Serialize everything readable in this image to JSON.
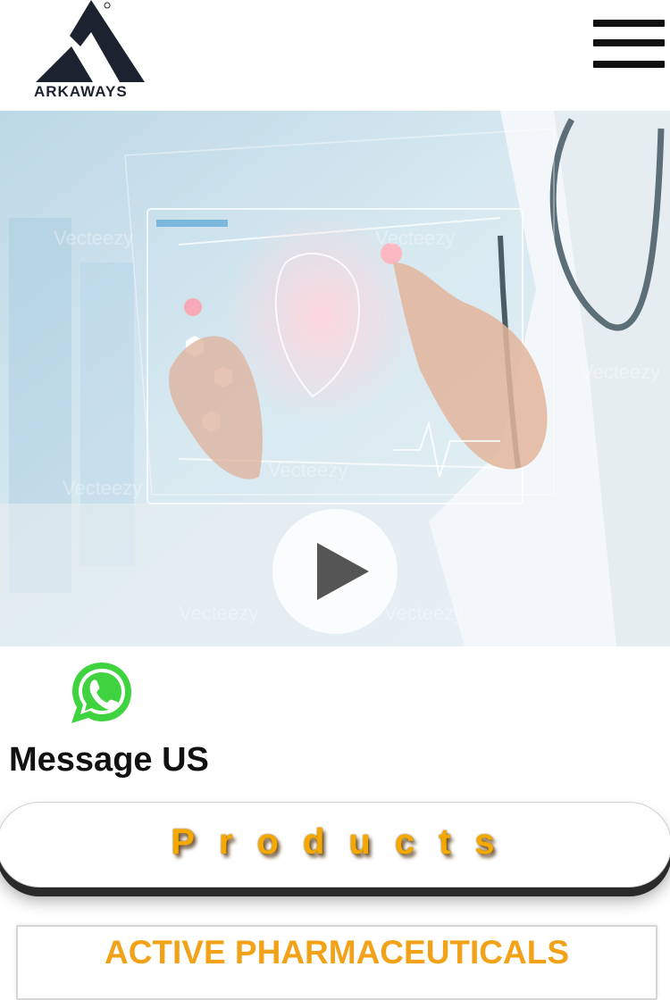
{
  "header": {
    "logo_text": "ARKAWAYS",
    "menu_icon": "hamburger-menu-icon"
  },
  "hero": {
    "watermark": "Vecteezy",
    "play_icon": "play-icon"
  },
  "contact": {
    "whatsapp_icon": "whatsapp-icon",
    "message_label": "Message US"
  },
  "products": {
    "label": "Products"
  },
  "categories": [
    {
      "label": "ACTIVE PHARMACEUTICALS"
    }
  ],
  "colors": {
    "accent_orange": "#f4a800",
    "whatsapp_green": "#3fd33f",
    "logo_navy": "#1d2230"
  }
}
